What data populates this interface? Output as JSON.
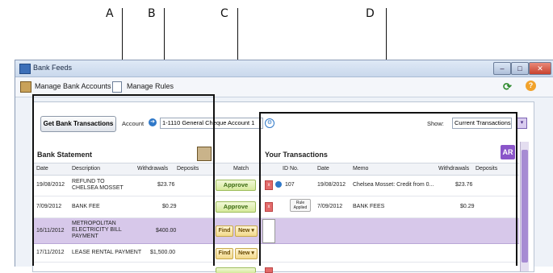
{
  "callouts": [
    "A",
    "B",
    "C",
    "D"
  ],
  "window": {
    "title": "Bank Feeds"
  },
  "toolbar": {
    "manage_accounts": "Manage Bank Accounts",
    "manage_rules": "Manage Rules"
  },
  "filters": {
    "get_button": "Get Bank Transactions",
    "account_label": "Account",
    "account_value": "1-1110 General Cheque Account 1",
    "show_label": "Show:",
    "show_value": "Current Transactions"
  },
  "bank_statement": {
    "title": "Bank Statement",
    "columns": [
      "Date",
      "Description",
      "Withdrawals",
      "Deposits"
    ]
  },
  "match_column": "Match",
  "your_transactions": {
    "title": "Your Transactions",
    "badge": "AR",
    "columns": [
      "ID No.",
      "Date",
      "Memo",
      "Withdrawals",
      "Deposits"
    ]
  },
  "rows": [
    {
      "date": "19/08/2012",
      "description": "REFUND TO CHELSEA MOSSET",
      "withdrawals": "$23.76",
      "deposits": "",
      "action": "Approve",
      "id": "107",
      "t_date": "19/08/2012",
      "memo": "Chelsea Mosset: Credit from 0...",
      "t_withdrawals": "$23.76",
      "t_deposits": ""
    },
    {
      "date": "7/09/2012",
      "description": "BANK FEE",
      "withdrawals": "$0.29",
      "deposits": "",
      "action": "Approve",
      "id": "Rule Applied",
      "t_date": "7/09/2012",
      "memo": "BANK FEES",
      "t_withdrawals": "$0.29",
      "t_deposits": ""
    },
    {
      "date": "16/11/2012",
      "description": "METROPOLITAN ELECTRICITY BILL PAYMENT",
      "withdrawals": "$400.00",
      "deposits": "",
      "find": "Find",
      "new": "New"
    },
    {
      "date": "17/11/2012",
      "description": "LEASE RENTAL PAYMENT",
      "withdrawals": "$1,500.00",
      "deposits": "",
      "find": "Find",
      "new": "New"
    }
  ]
}
